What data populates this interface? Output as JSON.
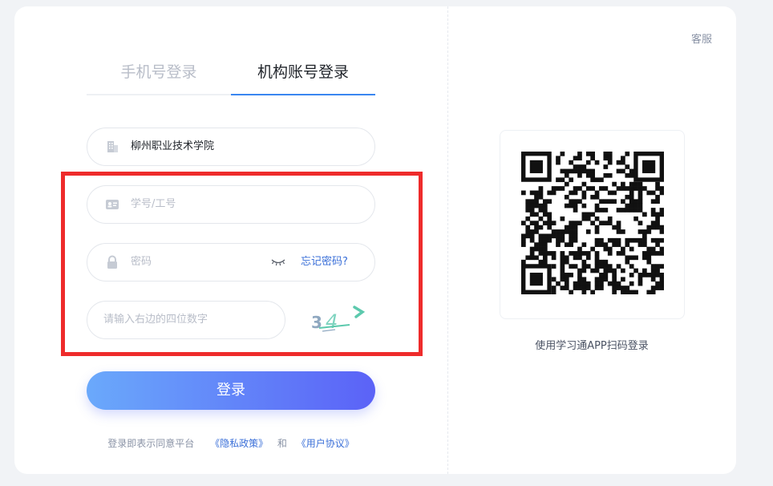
{
  "header": {
    "service_label": "客服"
  },
  "tabs": [
    {
      "label": "手机号登录",
      "active": false
    },
    {
      "label": "机构账号登录",
      "active": true
    }
  ],
  "form": {
    "institution": {
      "value": "柳州职业技术学院",
      "icon": "building-icon"
    },
    "account": {
      "placeholder": "学号/工号",
      "icon": "id-card-icon"
    },
    "password": {
      "placeholder": "密码",
      "icon": "lock-icon",
      "toggle_icon": "eye-closed-icon",
      "forgot_label": "忘记密码?"
    },
    "captcha": {
      "placeholder": "请输入右边的四位数字",
      "image_text": "3 4 7"
    },
    "login_label": "登录"
  },
  "agreement": {
    "prefix": "登录即表示同意平台",
    "privacy_link": "《隐私政策》",
    "and": "和",
    "terms_link": "《用户协议》"
  },
  "qr": {
    "caption": "使用学习通APP扫码登录"
  },
  "colors": {
    "accent": "#3a86f0",
    "link": "#3a6fd8",
    "button_gradient_start": "#6aa9fb",
    "button_gradient_end": "#5b62f7",
    "highlight": "#ee2b2b"
  }
}
